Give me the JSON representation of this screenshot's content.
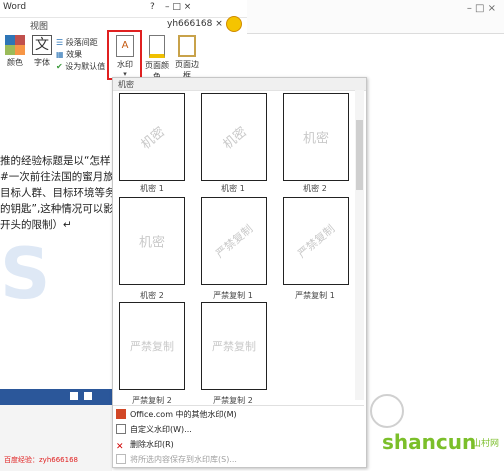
{
  "window": {
    "title": "Word",
    "user": "yh666168 ×",
    "help": "?",
    "controls": "–  □  ×"
  },
  "menu": {
    "tab_view": "视图"
  },
  "ribbon": {
    "colors_label": "颜色",
    "fonts_label": "字体",
    "paragraph_spacing": "段落间距",
    "effects": "效果",
    "set_default": "设为默认值",
    "watermark": "水印",
    "page_color": "页面颜色",
    "page_borders": "页面边框"
  },
  "document": {
    "lines": [
      "推的经验标题是以“怎样",
      "#一次前往法国的蜜月旅",
      "目标人群、目标环境等务",
      "的钥匙”,这种情况可以影",
      "开头的限制）↵"
    ],
    "footer": "百度经验：zyh666168"
  },
  "gallery": {
    "header": "机密",
    "thumbs": [
      {
        "text": "机密",
        "label": "机密 1",
        "diagonal": true
      },
      {
        "text": "机密",
        "label": "机密 1",
        "diagonal": true
      },
      {
        "text": "机密",
        "label": "机密 2",
        "diagonal": false
      },
      {
        "text": "机密",
        "label": "机密 2",
        "diagonal": false
      },
      {
        "text": "严禁复制",
        "label": "严禁复制 1",
        "diagonal": true
      },
      {
        "text": "严禁复制",
        "label": "严禁复制 1",
        "diagonal": true
      },
      {
        "text": "严禁复制",
        "label": "严禁复制 2",
        "diagonal": false
      },
      {
        "text": "严禁复制",
        "label": "严禁复制 2",
        "diagonal": false
      }
    ],
    "menu": [
      {
        "label": "Office.com 中的其他水印(M)",
        "icon": "office-icon",
        "enabled": true
      },
      {
        "label": "自定义水印(W)...",
        "icon": "custom-watermark-icon",
        "enabled": true
      },
      {
        "label": "删除水印(R)",
        "icon": "remove-watermark-icon",
        "enabled": true
      },
      {
        "label": "将所选内容保存到水印库(S)...",
        "icon": "save-to-gallery-icon",
        "enabled": false
      }
    ]
  },
  "brand": {
    "text": "shancun",
    "sub": "山村网",
    "accent": "#7bbf2a"
  }
}
